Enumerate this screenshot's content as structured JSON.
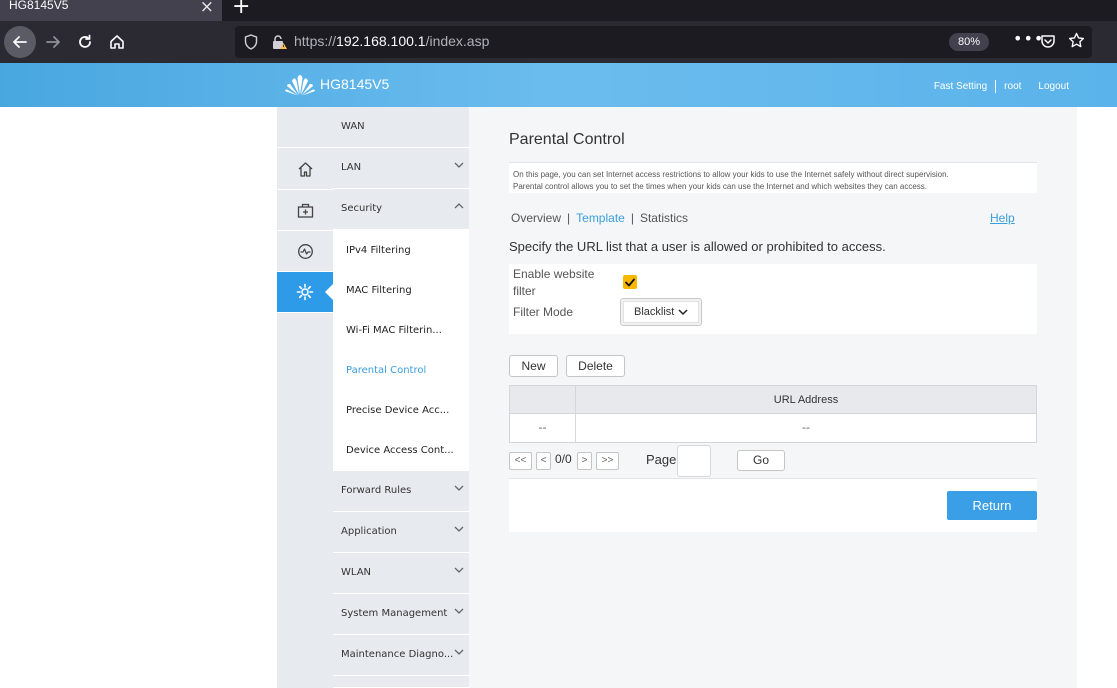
{
  "browser": {
    "tab_title": "HG8145V5",
    "url_scheme": "https://",
    "url_host": "192.168.100.1",
    "url_path": "/index.asp",
    "zoom": "80%"
  },
  "header": {
    "model": "HG8145V5",
    "fast_setting": "Fast Setting",
    "user": "root",
    "logout": "Logout"
  },
  "menu": {
    "items": [
      {
        "label": "WAN"
      },
      {
        "label": "LAN"
      },
      {
        "label": "Security"
      },
      {
        "label": "Forward Rules"
      },
      {
        "label": "Application"
      },
      {
        "label": "WLAN"
      },
      {
        "label": "System Management"
      },
      {
        "label": "Maintenance Diagno..."
      }
    ],
    "security_sub": [
      {
        "label": "IPv4 Filtering"
      },
      {
        "label": "MAC Filtering"
      },
      {
        "label": "Wi-Fi MAC Filterin..."
      },
      {
        "label": "Parental Control"
      },
      {
        "label": "Precise Device Acc..."
      },
      {
        "label": "Device Access Cont..."
      }
    ]
  },
  "icons": [
    "home-icon",
    "toolbox-icon",
    "diagnose-icon",
    "settings-icon"
  ],
  "content": {
    "title": "Parental Control",
    "desc_line1": "On this page, you can set Internet access restrictions to allow your kids to use the Internet safely without direct supervision.",
    "desc_line2": "Parental control allows you to set the times when your kids can use the Internet and which websites they can access.",
    "tabs": {
      "overview": "Overview",
      "template": "Template",
      "statistics": "Statistics",
      "sep": "|"
    },
    "help": "Help",
    "instruction": "Specify the URL list that a user is allowed or prohibited to access.",
    "enable_label_1": "Enable website",
    "enable_label_2": "filter",
    "filter_mode_label": "Filter Mode",
    "filter_mode_value": "Blacklist",
    "new_btn": "New",
    "delete_btn": "Delete",
    "table": {
      "header": "URL Address",
      "row_c1": "--",
      "row_c2": "--"
    },
    "pager": {
      "first": "<<",
      "prev": "<",
      "count": "0/0",
      "next": ">",
      "last": ">>",
      "page_label": "Page",
      "go": "Go"
    },
    "return_btn": "Return"
  },
  "colors": {
    "accent": "#3a9fe6",
    "header": "#5ab3ea",
    "checkbox": "#f8b700"
  }
}
